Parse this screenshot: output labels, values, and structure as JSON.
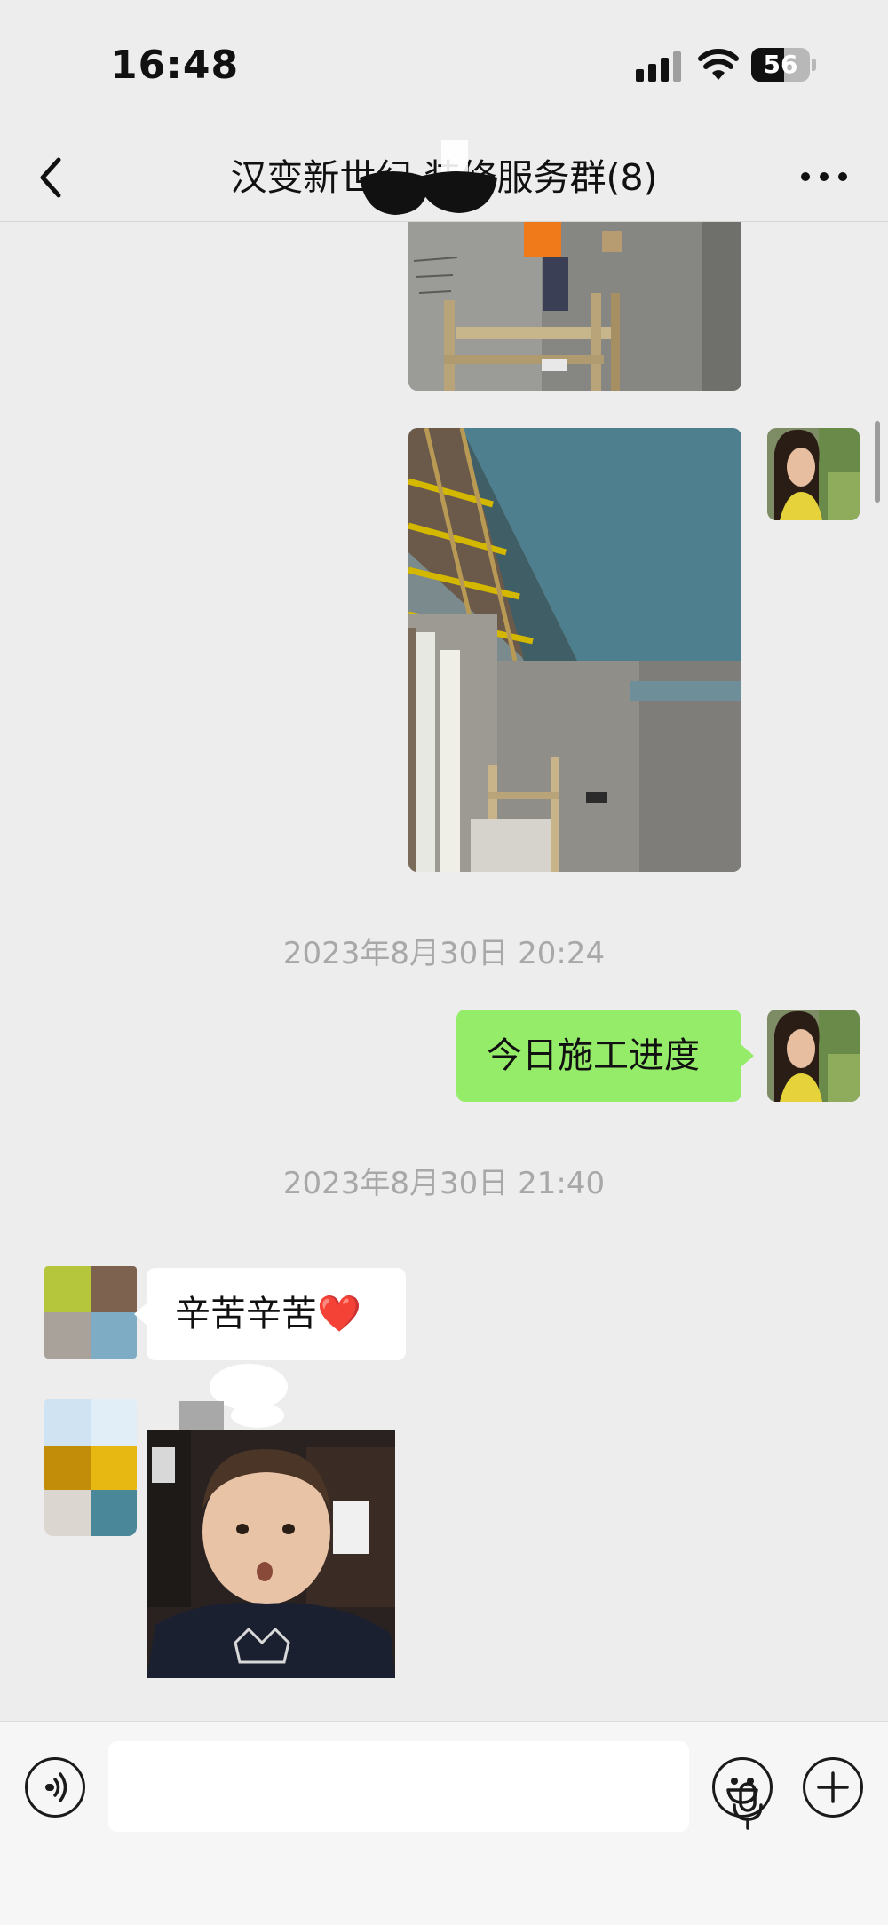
{
  "status_bar": {
    "time": "16:48",
    "battery_level": "56",
    "icons": [
      "signal-icon",
      "wifi-icon",
      "battery-icon"
    ]
  },
  "header": {
    "title": "汉变新世纪          装修服务群(8)",
    "back_icon": "chevron-left-icon",
    "more_icon": "more-icon"
  },
  "messages": [
    {
      "type": "image",
      "sender": "self",
      "description_icon": "photo-construction-ladder"
    },
    {
      "type": "image",
      "sender": "self",
      "description_icon": "photo-ceiling-frame"
    },
    {
      "type": "timestamp",
      "text": "2023年8月30日 20:24"
    },
    {
      "type": "text",
      "sender": "self",
      "text": "今日施工进度"
    },
    {
      "type": "timestamp",
      "text": "2023年8月30日 21:40"
    },
    {
      "type": "text",
      "sender": "other",
      "text": "辛苦辛苦❤️"
    },
    {
      "type": "sticker",
      "sender": "other",
      "description_icon": "sticker-baby"
    }
  ],
  "input_bar": {
    "voice_icon": "voice-mode-icon",
    "mic_icon": "microphone-icon",
    "emoji_icon": "emoji-icon",
    "plus_icon": "plus-icon",
    "placeholder": ""
  },
  "colors": {
    "background": "#ededed",
    "self_bubble": "#95ec69",
    "other_bubble": "#ffffff",
    "timestamp_text": "#a8a8a8"
  }
}
